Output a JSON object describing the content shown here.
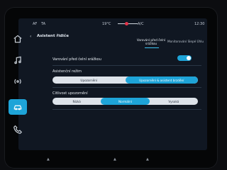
{
  "status": {
    "left1": "AF",
    "left2": "TA",
    "temp": "19°C",
    "ac": "A/C",
    "time": "12:30"
  },
  "header": {
    "back_label": "‹",
    "title": "Asistent řidiče",
    "tabs": [
      {
        "label": "Varování před čelní srážkou",
        "active": true
      },
      {
        "label": "Monitorování Slepé Úhlu"
      }
    ]
  },
  "settings": {
    "collision_warning": {
      "label": "Varování před čelní srážkou",
      "enabled": true
    },
    "assist_mode": {
      "label": "Asistenční režim",
      "options": [
        "Upozornění",
        "Upozornění & asistent brzdění"
      ],
      "selected_index": 1
    },
    "sensitivity": {
      "label": "Citlivost upozornění",
      "options": [
        "Nízká",
        "Normální",
        "Vysoká"
      ],
      "selected_index": 1
    }
  },
  "sidebar": {
    "items": [
      {
        "icon": "home-icon"
      },
      {
        "icon": "music-icon"
      },
      {
        "icon": "radio-icon"
      },
      {
        "icon": "car-icon",
        "active": true
      },
      {
        "icon": "phone-icon"
      }
    ]
  },
  "colors": {
    "accent": "#1ea4d8",
    "background": "#101722"
  }
}
